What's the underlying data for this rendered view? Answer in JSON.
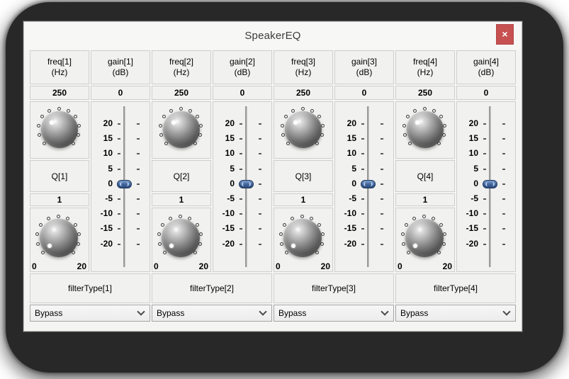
{
  "window": {
    "title": "SpeakerEQ",
    "close_glyph": "×"
  },
  "palette": {
    "close_button_bg": "#c75050",
    "slider_handle": "#3f639b",
    "knob_indicator": "#ffffff",
    "cell_border": "#cfcfcf",
    "window_bg": "#f4f4f3",
    "backdrop": "#282828"
  },
  "gain_slider": {
    "tick_labels": [
      "20",
      "15",
      "10",
      "5",
      "0",
      "-5",
      "-10",
      "-15",
      "-20"
    ],
    "handle_at_label": "0"
  },
  "channels": [
    {
      "freq_label": "freq[1]",
      "freq_unit": "(Hz)",
      "freq_value": "250",
      "gain_label": "gain[1]",
      "gain_unit": "(dB)",
      "gain_value": "0",
      "q_label": "Q[1]",
      "q_value": "1",
      "q_scale_min": "0",
      "q_scale_max": "20",
      "filter_label": "filterType[1]",
      "filter_value": "Bypass"
    },
    {
      "freq_label": "freq[2]",
      "freq_unit": "(Hz)",
      "freq_value": "250",
      "gain_label": "gain[2]",
      "gain_unit": "(dB)",
      "gain_value": "0",
      "q_label": "Q[2]",
      "q_value": "1",
      "q_scale_min": "0",
      "q_scale_max": "20",
      "filter_label": "filterType[2]",
      "filter_value": "Bypass"
    },
    {
      "freq_label": "freq[3]",
      "freq_unit": "(Hz)",
      "freq_value": "250",
      "gain_label": "gain[3]",
      "gain_unit": "(dB)",
      "gain_value": "0",
      "q_label": "Q[3]",
      "q_value": "1",
      "q_scale_min": "0",
      "q_scale_max": "20",
      "filter_label": "filterType[3]",
      "filter_value": "Bypass"
    },
    {
      "freq_label": "freq[4]",
      "freq_unit": "(Hz)",
      "freq_value": "250",
      "gain_label": "gain[4]",
      "gain_unit": "(dB)",
      "gain_value": "0",
      "q_label": "Q[4]",
      "q_value": "1",
      "q_scale_min": "0",
      "q_scale_max": "20",
      "filter_label": "filterType[4]",
      "filter_value": "Bypass"
    }
  ]
}
